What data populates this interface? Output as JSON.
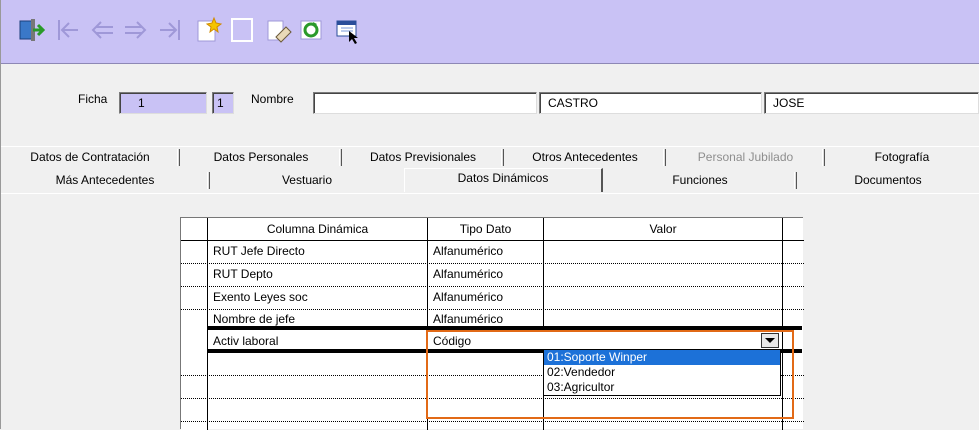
{
  "toolbar": {
    "icons": [
      "exit-icon",
      "first-record-icon",
      "previous-record-icon",
      "next-record-icon",
      "last-record-icon",
      "new-record-icon",
      "blank-icon",
      "clear-icon",
      "refresh-icon",
      "query-icon"
    ]
  },
  "header": {
    "ficha_label": "Ficha",
    "ficha_value": "1",
    "ficha_secondary": "1",
    "nombre_label": "Nombre",
    "nombre_value": "",
    "apellido_value": "CASTRO",
    "nombre2_value": "JOSE"
  },
  "tabs_row1": [
    {
      "label": "Datos de Contratación"
    },
    {
      "label": "Datos Personales"
    },
    {
      "label": "Datos Previsionales"
    },
    {
      "label": "Otros Antecedentes"
    },
    {
      "label": "Personal Jubilado"
    },
    {
      "label": "Fotografía"
    }
  ],
  "tabs_row2": [
    {
      "label": "Más Antecedentes"
    },
    {
      "label": "Vestuario"
    },
    {
      "label": "Datos Dinámicos"
    },
    {
      "label": "Funciones"
    },
    {
      "label": "Documentos"
    }
  ],
  "grid": {
    "columns": [
      "Columna Dinámica",
      "Tipo Dato",
      "Valor"
    ],
    "rows": [
      [
        "RUT Jefe Directo",
        "Alfanumérico",
        ""
      ],
      [
        "RUT Depto",
        "Alfanumérico",
        ""
      ],
      [
        "Exento Leyes soc",
        "Alfanumérico",
        ""
      ],
      [
        "Nombre de jefe",
        "Alfanumérico",
        ""
      ],
      [
        "Activ laboral",
        "Código",
        ""
      ]
    ]
  },
  "dropdown": {
    "options": [
      "01:Soporte Winper",
      "02:Vendedor",
      "03:Agricultor"
    ],
    "selected_index": 0
  },
  "colors": {
    "toolbar_bg": "#c9c2f5",
    "highlight_border": "#e26a17",
    "selection_bg": "#1c71d8"
  }
}
